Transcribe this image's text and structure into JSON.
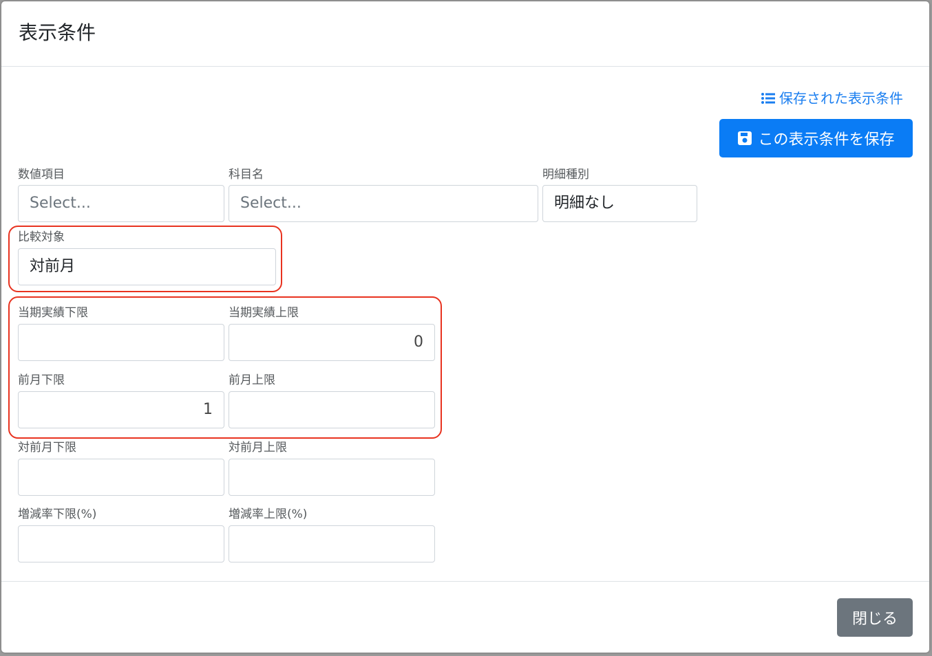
{
  "modal": {
    "title": "表示条件"
  },
  "actions": {
    "saved_conditions_link": "保存された表示条件",
    "save_button": "この表示条件を保存",
    "close_button": "閉じる"
  },
  "fields": {
    "numeric_item": {
      "label": "数値項目",
      "value": "",
      "placeholder": "Select..."
    },
    "account_name": {
      "label": "科目名",
      "value": "",
      "placeholder": "Select..."
    },
    "detail_type": {
      "label": "明細種別",
      "value": "明細なし"
    },
    "comparison_target": {
      "label": "比較対象",
      "value": "対前月"
    },
    "current_actual_lower": {
      "label": "当期実績下限",
      "value": ""
    },
    "current_actual_upper": {
      "label": "当期実績上限",
      "value": "0"
    },
    "prev_month_lower": {
      "label": "前月下限",
      "value": "1"
    },
    "prev_month_upper": {
      "label": "前月上限",
      "value": ""
    },
    "vs_prev_month_lower": {
      "label": "対前月下限",
      "value": ""
    },
    "vs_prev_month_upper": {
      "label": "対前月上限",
      "value": ""
    },
    "change_rate_lower": {
      "label": "増減率下限(%)",
      "value": ""
    },
    "change_rate_upper": {
      "label": "増減率上限(%)",
      "value": ""
    }
  },
  "icons": {
    "saved_link_icon": "list-icon",
    "save_button_icon": "floppy-disk-icon"
  },
  "colors": {
    "primary": "#0a7cf5",
    "link": "#1a7ef0",
    "secondary": "#6c757d",
    "highlight": "#e8321f"
  }
}
